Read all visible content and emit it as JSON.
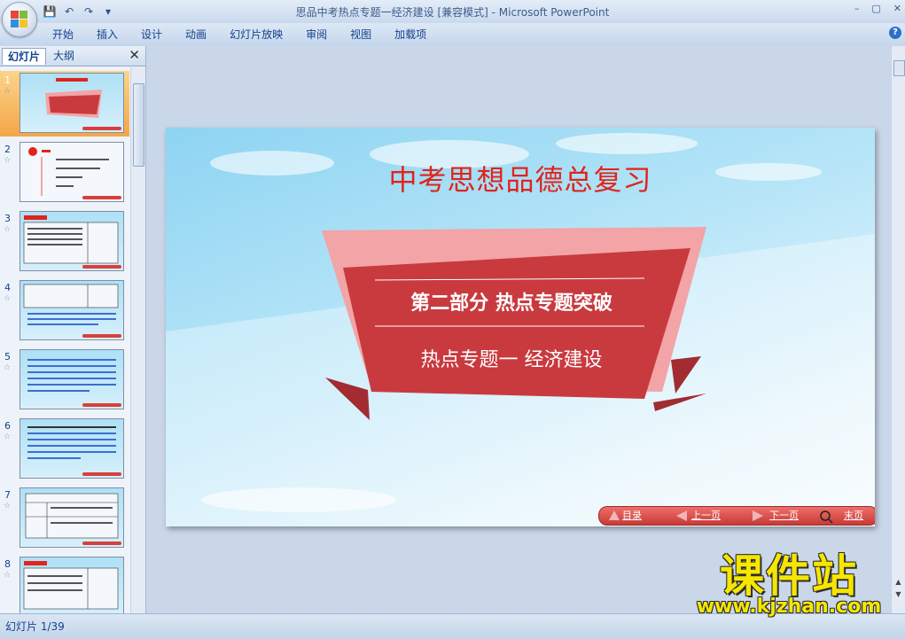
{
  "window": {
    "title": "思品中考热点专题一经济建设 [兼容模式] - Microsoft PowerPoint",
    "controls": [
      "–",
      "▢",
      "✕"
    ]
  },
  "ribbon": {
    "tabs": [
      "开始",
      "插入",
      "设计",
      "动画",
      "幻灯片放映",
      "审阅",
      "视图",
      "加载项"
    ]
  },
  "left_pane": {
    "tab_slides": "幻灯片",
    "tab_outline": "大纲",
    "close_glyph": "✕",
    "thumbnails": [
      {
        "number": "1",
        "selected": true
      },
      {
        "number": "2",
        "selected": false
      },
      {
        "number": "3",
        "selected": false
      },
      {
        "number": "4",
        "selected": false
      },
      {
        "number": "5",
        "selected": false
      },
      {
        "number": "6",
        "selected": false
      },
      {
        "number": "7",
        "selected": false
      },
      {
        "number": "8",
        "selected": false
      }
    ],
    "star_glyph": "☆"
  },
  "slide": {
    "title": "中考思想品德总复习",
    "banner_line1": "第二部分 热点专题突破",
    "banner_line2": "热点专题一 经济建设",
    "nav": {
      "toc": "目录",
      "prev": "上一页",
      "next": "下一页",
      "end": "末页"
    }
  },
  "status": {
    "slide_position": "幻灯片 1/39"
  },
  "watermark": {
    "text": "课件站",
    "url": "www.kjzhan.com"
  },
  "colors": {
    "slide_title": "#e0241c",
    "banner_red": "#c93a3f",
    "banner_pink": "#f2a4a6",
    "selected_thumb": "#f5a548"
  }
}
